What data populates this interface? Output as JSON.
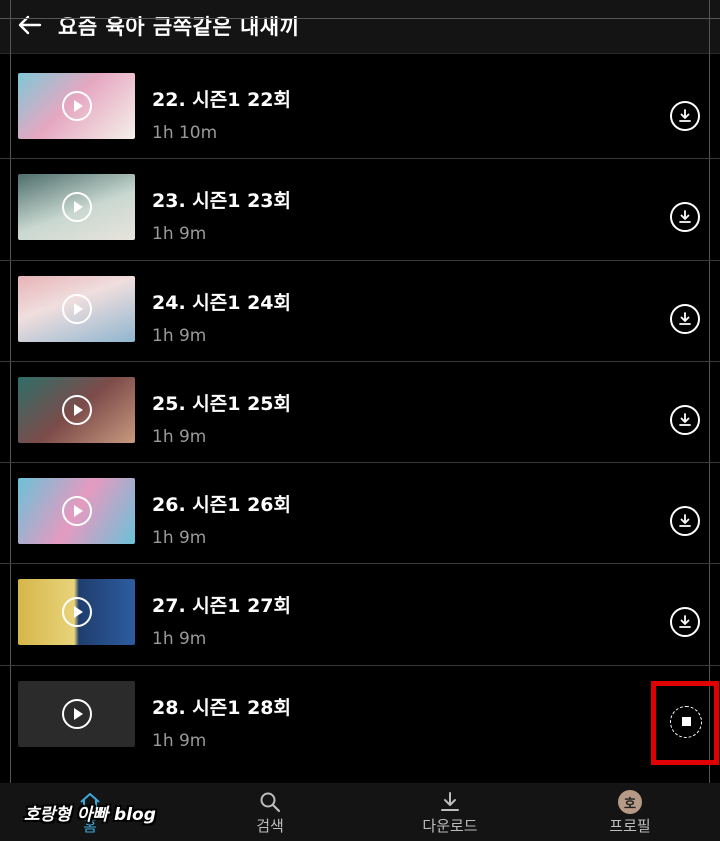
{
  "header": {
    "title": "요즘 육아 금쪽같은 내새끼"
  },
  "episodes": [
    {
      "title": "22. 시즌1 22회",
      "duration": "1h 10m",
      "status": "download"
    },
    {
      "title": "23. 시즌1 23회",
      "duration": "1h 9m",
      "status": "download"
    },
    {
      "title": "24. 시즌1 24회",
      "duration": "1h 9m",
      "status": "download"
    },
    {
      "title": "25. 시즌1 25회",
      "duration": "1h 9m",
      "status": "download"
    },
    {
      "title": "26. 시즌1 26회",
      "duration": "1h 9m",
      "status": "download"
    },
    {
      "title": "27. 시즌1 27회",
      "duration": "1h 9m",
      "status": "download"
    },
    {
      "title": "28. 시즌1 28회",
      "duration": "1h 9m",
      "status": "downloading"
    }
  ],
  "nav": {
    "home_label": "홈",
    "search_label": "검색",
    "downloads_label": "다운로드",
    "profile_label": "프로필",
    "profile_initial": "호",
    "active": "home"
  },
  "watermark": "호랑형 아빠 blog",
  "colors": {
    "accent": "#3ea8d8",
    "highlight": "#e00000",
    "background": "#000000"
  }
}
